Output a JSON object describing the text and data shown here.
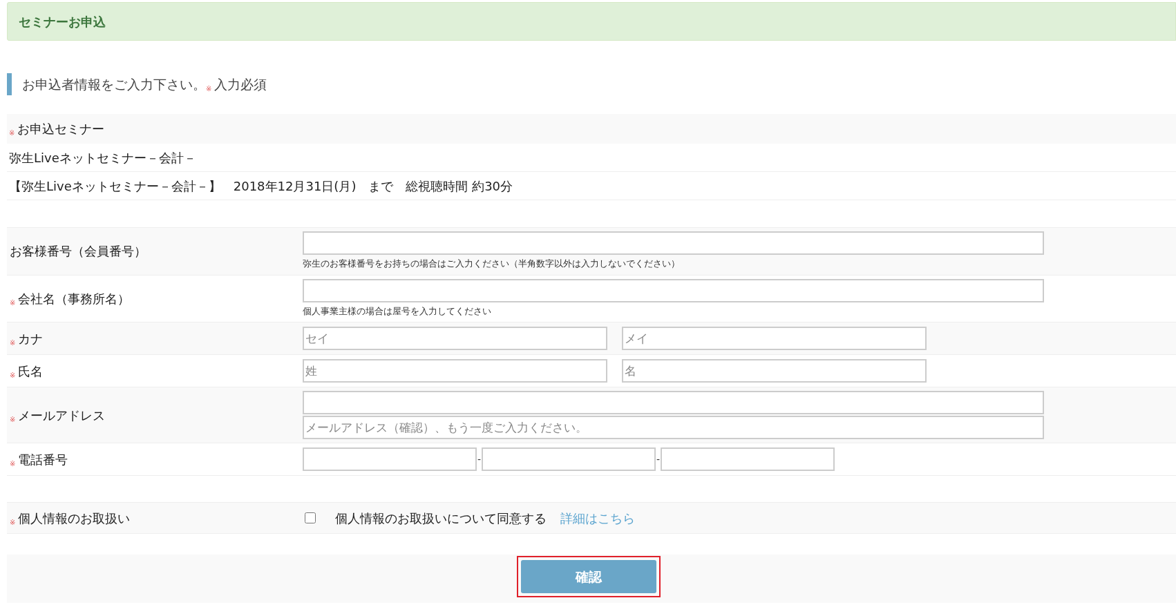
{
  "page_title": "セミナーお申込",
  "section": {
    "heading": "お申込者情報をご入力下さい。",
    "required_note": {
      "mark": "※",
      "text": "入力必須"
    }
  },
  "seminar": {
    "label": {
      "mark": "※",
      "text": "お申込セミナー"
    },
    "rows": [
      "弥生Liveネットセミナー－会計－",
      "【弥生Liveネットセミナー－会計－】　2018年12月31日(月)　まで　総視聴時間 約30分"
    ]
  },
  "fields": [
    {
      "kind": "single",
      "label": "お客様番号（会員番号）",
      "help": "弥生のお客様番号をお持ちの場合はご入力ください（半角数字以外は入力しないでください）"
    },
    {
      "kind": "single",
      "label": "会社名（事務所名）",
      "mark": "※",
      "help": "個人事業主様の場合は屋号を入力してください"
    },
    {
      "kind": "pair",
      "label": "カナ",
      "mark": "※",
      "placeholders": [
        "セイ",
        "メイ"
      ]
    },
    {
      "kind": "pair",
      "label": "氏名",
      "mark": "※",
      "placeholders": [
        "姓",
        "名"
      ]
    },
    {
      "kind": "stack",
      "label": "メールアドレス",
      "mark": "※",
      "confirm_placeholder": "メールアドレス（確認）、もう一度ご入力ください。"
    },
    {
      "kind": "phone",
      "label": "電話番号",
      "mark": "※",
      "separators": [
        "-",
        "-"
      ]
    }
  ],
  "privacy": {
    "label": {
      "mark": "※",
      "text": "個人情報のお取扱い"
    },
    "checked": false,
    "agree_text": "個人情報のお取扱いについて同意する",
    "link": "詳細はこちら"
  },
  "submit": {
    "label": "確認"
  }
}
